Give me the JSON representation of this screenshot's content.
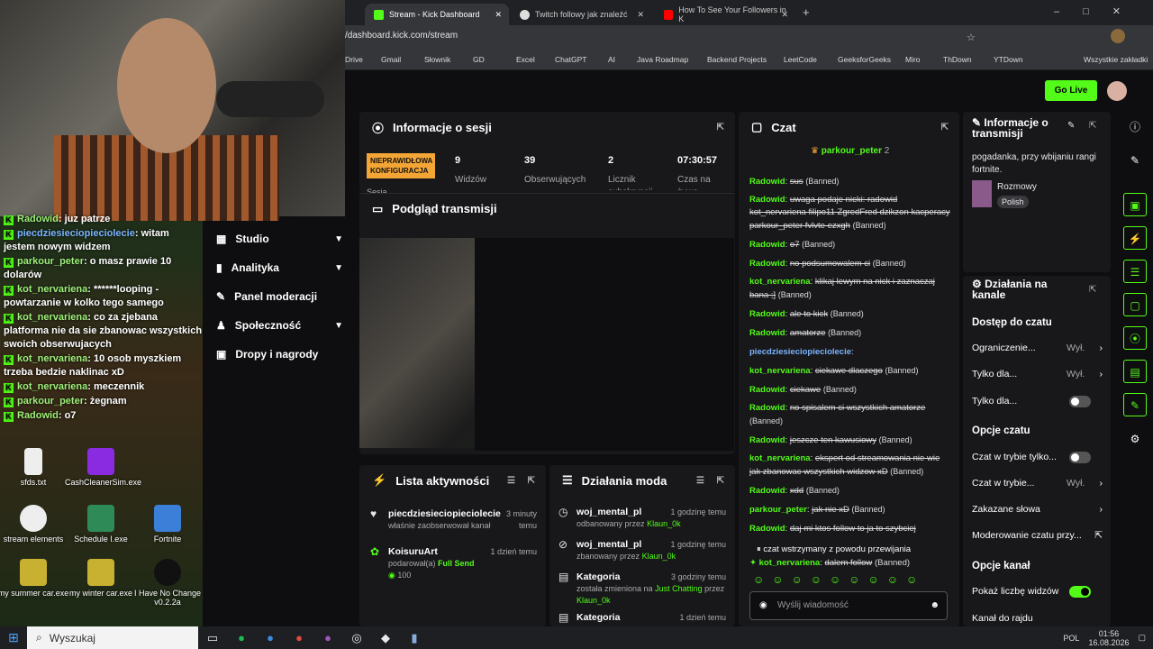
{
  "browser": {
    "tabs": [
      {
        "label": "Stream - Kick Dashboard"
      },
      {
        "label": "Twitch followy jak znaleźć"
      },
      {
        "label": "How To See Your Followers in K"
      }
    ],
    "url": "/dashboard.kick.com/stream",
    "bookmarks": [
      "Drive",
      "Gmail",
      "Słownik",
      "GD",
      "Excel",
      "ChatGPT",
      "AI",
      "Java Roadmap",
      "Backend Projects",
      "LeetCode",
      "GeeksforGeeks",
      "Miro",
      "ThDown",
      "YTDown",
      "Wszystkie zakładki"
    ]
  },
  "overlay_chat": [
    {
      "user": "Radowid",
      "text": "juz patrze"
    },
    {
      "user": "piecdziesieciopieciolecie",
      "text": "witam jestem nowym widzem"
    },
    {
      "user": "parkour_peter",
      "text": "o masz prawie 10 dolarów"
    },
    {
      "user": "kot_nervariena",
      "text": "******looping - powtarzanie w kolko tego samego"
    },
    {
      "user": "kot_nervariena",
      "text": "co za zjebana platforma nie da sie zbanowac wszystkich swoich obserwujacych"
    },
    {
      "user": "kot_nervariena",
      "text": "10 osob myszkiem trzeba bedzie naklinac xD"
    },
    {
      "user": "kot_nervariena",
      "text": "meczennik"
    },
    {
      "user": "parkour_peter",
      "text": "żegnam"
    },
    {
      "user": "Radowid",
      "text": "o7"
    }
  ],
  "desktop_icons": [
    {
      "label": "sfds.txt"
    },
    {
      "label": "CashCleanerSim.exe"
    },
    {
      "label": "stream elements"
    },
    {
      "label": "Schedule I.exe"
    },
    {
      "label": "Fortnite"
    },
    {
      "label": "my summer car.exe"
    },
    {
      "label": "my winter car.exe"
    },
    {
      "label": "I Have No Change v0.2.2a"
    }
  ],
  "nav": [
    "Studio",
    "Analityka",
    "Panel moderacji",
    "Społeczność",
    "Dropy i nagrody"
  ],
  "session": {
    "title": "Informacje o sesji",
    "badge": "NIEPRAWIDŁOWA KONFIGURACJA",
    "badge_sub": "Sesja",
    "stats": [
      {
        "value": "9",
        "label": "Widzów"
      },
      {
        "value": "39",
        "label": "Obserwujących"
      },
      {
        "value": "2",
        "label": "Licznik subskrypcji"
      },
      {
        "value": "07:30:57",
        "label": "Czas na żywo"
      }
    ]
  },
  "preview": {
    "title": "Podgląd transmisji"
  },
  "activity": {
    "title": "Lista aktywności",
    "items": [
      {
        "name": "piecdziesieciopieciolecie",
        "desc": "właśnie zaobserwował kanał",
        "time": "3 minuty temu"
      },
      {
        "name": "KoisuruArt",
        "desc": "podarował(a)",
        "highlight": "Full Send",
        "amount": "100",
        "time": "1 dzień temu"
      }
    ]
  },
  "modactions": {
    "title": "Działania moda",
    "items": [
      {
        "name": "woj_mental_pl",
        "desc": "odbanowany przez",
        "by": "Klaun_0k",
        "time": "1 godzinę temu"
      },
      {
        "name": "woj_mental_pl",
        "desc": "zbanowany przez",
        "by": "Klaun_0k",
        "time": "1 godzinę temu"
      },
      {
        "name": "Kategoria",
        "desc": "została zmieniona na",
        "target": "Just Chatting",
        "by2": "przez",
        "by": "Klaun_0k",
        "time": "3 godziny temu"
      },
      {
        "name": "Kategoria",
        "desc": "",
        "by": "",
        "time": "1 dzień temu"
      }
    ]
  },
  "chat": {
    "title": "Czat",
    "pinned_user": "parkour_peter",
    "pinned_count": "2",
    "messages": [
      {
        "user": "Radowid",
        "text": "sus",
        "tag": "(Banned)"
      },
      {
        "user": "Radowid",
        "text": "uwaga podaje nicki: radowid kot_nervariena filipo11 ZgredFred dzikzon kacperacy parkour_peter fvlvte ezxgh",
        "tag": "(Banned)"
      },
      {
        "user": "Radowid",
        "text": "o7",
        "tag": "(Banned)"
      },
      {
        "user": "Radowid",
        "text": "no podsumowalem ci",
        "tag": "(Banned)"
      },
      {
        "user": "kot_nervariena",
        "text": "klikaj lewym na nick i zaznaczaj bana ;]",
        "tag": "(Banned)"
      },
      {
        "user": "Radowid",
        "text": "ale to kick",
        "tag": "(Banned)"
      },
      {
        "user": "Radowid",
        "text": "amatorze",
        "tag": "(Banned)"
      },
      {
        "user": "piecdziesieciopieciolecie",
        "text": "",
        "tag": ""
      },
      {
        "user": "kot_nervariena",
        "text": "ciekawe dlaczego",
        "tag": "(Banned)"
      },
      {
        "user": "Radowid",
        "text": "ciekawe",
        "tag": "(Banned)"
      },
      {
        "user": "Radowid",
        "text": "no spisalem ci wszystkich amatorze",
        "tag": "(Banned)"
      },
      {
        "user": "Radowid",
        "text": "jeszcze ten kawusiowy",
        "tag": "(Banned)"
      },
      {
        "user": "kot_nervariena",
        "text": "ekspert od streamowania nie wie jak zbanowac wszystkich widzow xD",
        "tag": "(Banned)"
      },
      {
        "user": "Radowid",
        "text": "xdd",
        "tag": "(Banned)"
      },
      {
        "user": "parkour_peter",
        "text": "jak nie xD",
        "tag": "(Banned)"
      },
      {
        "user": "Radowid",
        "text": "daj mi ktos follow to ja to szybciej",
        "tag": ""
      }
    ],
    "paused": "czat wstrzymany z powodu przewijania",
    "last_user": "kot_nervariena",
    "last_text": "dalem follow",
    "last_tag": "(Banned)",
    "input_placeholder": "Wyślij wiadomość"
  },
  "stream_info": {
    "title": "Informacje o transmisji",
    "description": "pogadanka, przy wbijaniu rangi fortnite.",
    "category": "Rozmowy",
    "language": "Polish"
  },
  "channel_actions": {
    "title": "Działania na kanale",
    "sections": [
      {
        "header": "Dostęp do czatu",
        "rows": [
          {
            "label": "Ograniczenie...",
            "value": "Wył."
          },
          {
            "label": "Tylko dla...",
            "value": "Wył."
          },
          {
            "label": "Tylko dla...",
            "value": ""
          }
        ]
      },
      {
        "header": "Opcje czatu",
        "rows": [
          {
            "label": "Czat w trybie tylko...",
            "value": ""
          },
          {
            "label": "Czat w trybie...",
            "value": "Wył."
          },
          {
            "label": "Zakazane słowa",
            "value": ""
          },
          {
            "label": "Moderowanie czatu przy...",
            "value": ""
          }
        ]
      },
      {
        "header": "Opcje kanał",
        "rows": [
          {
            "label": "Pokaż liczbę widzów",
            "value": ""
          },
          {
            "label": "Kanał do rajdu",
            "value": ""
          }
        ]
      }
    ]
  },
  "golive": "Go Live",
  "taskbar": {
    "search": "Wyszukaj",
    "lang": "POL",
    "time": "01:56",
    "date": "16.08.2026"
  },
  "colors": {
    "kick_green": "#53fc18",
    "badge_orange": "#f3a536",
    "panel": "#18181b",
    "bg": "#0e0e10"
  }
}
